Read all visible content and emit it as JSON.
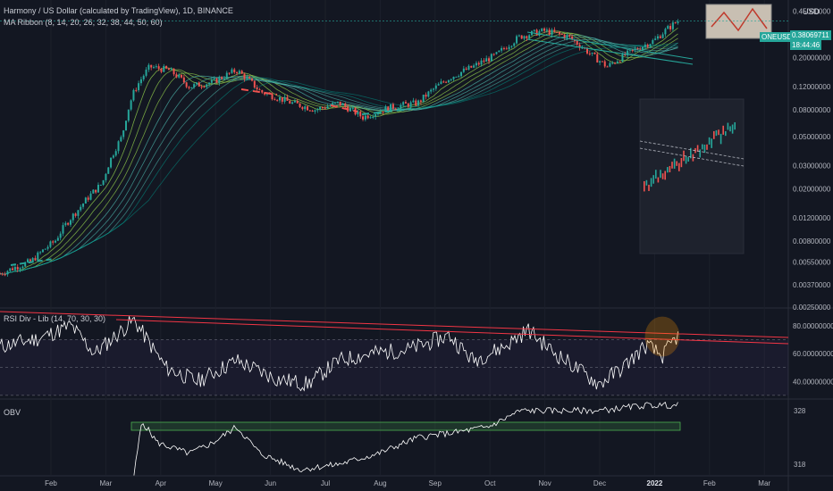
{
  "header": {
    "symbol_title": "Harmony / US Dollar (calculated by TradingView), 1D, BINANCE",
    "indicator_ma": "MA Ribbon (8, 14, 20, 26, 32, 38, 44, 50, 60)",
    "currency": "USD"
  },
  "price_tag": {
    "symbol": "ONEUSD",
    "price": "0.38069711",
    "countdown": "18:44:46"
  },
  "colors": {
    "background": "#131722",
    "up": "#26a69a",
    "down": "#ef5350",
    "rsi_line": "#ffffff",
    "trend_red": "#f23645",
    "obv_box": "#4caf50",
    "ribbon_fast": "#8bc34a",
    "ribbon_slow": "#009688"
  },
  "chart_data": [
    {
      "type": "candlestick",
      "name": "price",
      "scale": "log",
      "ylim": [
        0.0025,
        0.5
      ],
      "y_ticks": [
        "0.45000000",
        "0.20000000",
        "0.12000000",
        "0.08000000",
        "0.05000000",
        "0.03000000",
        "0.02000000",
        "0.01200000",
        "0.00800000",
        "0.00550000",
        "0.00370000",
        "0.00250000"
      ],
      "x_ticks": [
        "Feb",
        "Mar",
        "Apr",
        "May",
        "Jun",
        "Jul",
        "Aug",
        "Sep",
        "Oct",
        "Nov",
        "Dec",
        "2022",
        "Feb",
        "Mar"
      ],
      "anchors": [
        {
          "t": 0,
          "v": 0.0045
        },
        {
          "t": 0.04,
          "v": 0.0056
        },
        {
          "t": 0.07,
          "v": 0.008
        },
        {
          "t": 0.1,
          "v": 0.014
        },
        {
          "t": 0.13,
          "v": 0.022
        },
        {
          "t": 0.155,
          "v": 0.05
        },
        {
          "t": 0.17,
          "v": 0.11
        },
        {
          "t": 0.19,
          "v": 0.17
        },
        {
          "t": 0.215,
          "v": 0.16
        },
        {
          "t": 0.24,
          "v": 0.12
        },
        {
          "t": 0.27,
          "v": 0.13
        },
        {
          "t": 0.3,
          "v": 0.16
        },
        {
          "t": 0.33,
          "v": 0.11
        },
        {
          "t": 0.37,
          "v": 0.09
        },
        {
          "t": 0.4,
          "v": 0.08
        },
        {
          "t": 0.43,
          "v": 0.09
        },
        {
          "t": 0.46,
          "v": 0.07
        },
        {
          "t": 0.5,
          "v": 0.085
        },
        {
          "t": 0.53,
          "v": 0.09
        },
        {
          "t": 0.57,
          "v": 0.14
        },
        {
          "t": 0.6,
          "v": 0.17
        },
        {
          "t": 0.63,
          "v": 0.21
        },
        {
          "t": 0.66,
          "v": 0.29
        },
        {
          "t": 0.69,
          "v": 0.32
        },
        {
          "t": 0.72,
          "v": 0.29
        },
        {
          "t": 0.75,
          "v": 0.21
        },
        {
          "t": 0.77,
          "v": 0.17
        },
        {
          "t": 0.8,
          "v": 0.22
        },
        {
          "t": 0.83,
          "v": 0.27
        },
        {
          "t": 0.86,
          "v": 0.38
        }
      ]
    },
    {
      "type": "line",
      "name": "rsi",
      "title": "RSI Div - Lib (14, 70, 30, 30)",
      "ylim": [
        28,
        92
      ],
      "y_ticks": [
        "80.00000000",
        "60.00000000",
        "40.00000000"
      ],
      "anchors": [
        {
          "t": 0,
          "v": 65
        },
        {
          "t": 0.05,
          "v": 71
        },
        {
          "t": 0.09,
          "v": 80
        },
        {
          "t": 0.12,
          "v": 60
        },
        {
          "t": 0.17,
          "v": 84
        },
        {
          "t": 0.21,
          "v": 50
        },
        {
          "t": 0.25,
          "v": 40
        },
        {
          "t": 0.3,
          "v": 55
        },
        {
          "t": 0.35,
          "v": 42
        },
        {
          "t": 0.39,
          "v": 38
        },
        {
          "t": 0.43,
          "v": 55
        },
        {
          "t": 0.47,
          "v": 60
        },
        {
          "t": 0.52,
          "v": 63
        },
        {
          "t": 0.57,
          "v": 73
        },
        {
          "t": 0.6,
          "v": 55
        },
        {
          "t": 0.64,
          "v": 65
        },
        {
          "t": 0.67,
          "v": 77
        },
        {
          "t": 0.7,
          "v": 62
        },
        {
          "t": 0.73,
          "v": 50
        },
        {
          "t": 0.76,
          "v": 38
        },
        {
          "t": 0.79,
          "v": 50
        },
        {
          "t": 0.82,
          "v": 66
        },
        {
          "t": 0.84,
          "v": 58
        },
        {
          "t": 0.86,
          "v": 73
        }
      ]
    },
    {
      "type": "line",
      "name": "obv",
      "title": "OBV",
      "ylim": [
        316,
        330
      ],
      "y_ticks": [
        "328",
        "318"
      ],
      "anchors": [
        {
          "t": 0.17,
          "v": 316
        },
        {
          "t": 0.18,
          "v": 326
        },
        {
          "t": 0.2,
          "v": 322
        },
        {
          "t": 0.24,
          "v": 320
        },
        {
          "t": 0.27,
          "v": 322
        },
        {
          "t": 0.3,
          "v": 325
        },
        {
          "t": 0.33,
          "v": 320
        },
        {
          "t": 0.38,
          "v": 317
        },
        {
          "t": 0.43,
          "v": 318
        },
        {
          "t": 0.48,
          "v": 320
        },
        {
          "t": 0.53,
          "v": 323
        },
        {
          "t": 0.58,
          "v": 324
        },
        {
          "t": 0.62,
          "v": 325
        },
        {
          "t": 0.66,
          "v": 328
        },
        {
          "t": 0.7,
          "v": 328
        },
        {
          "t": 0.76,
          "v": 328
        },
        {
          "t": 0.82,
          "v": 329
        },
        {
          "t": 0.86,
          "v": 329
        }
      ]
    }
  ]
}
